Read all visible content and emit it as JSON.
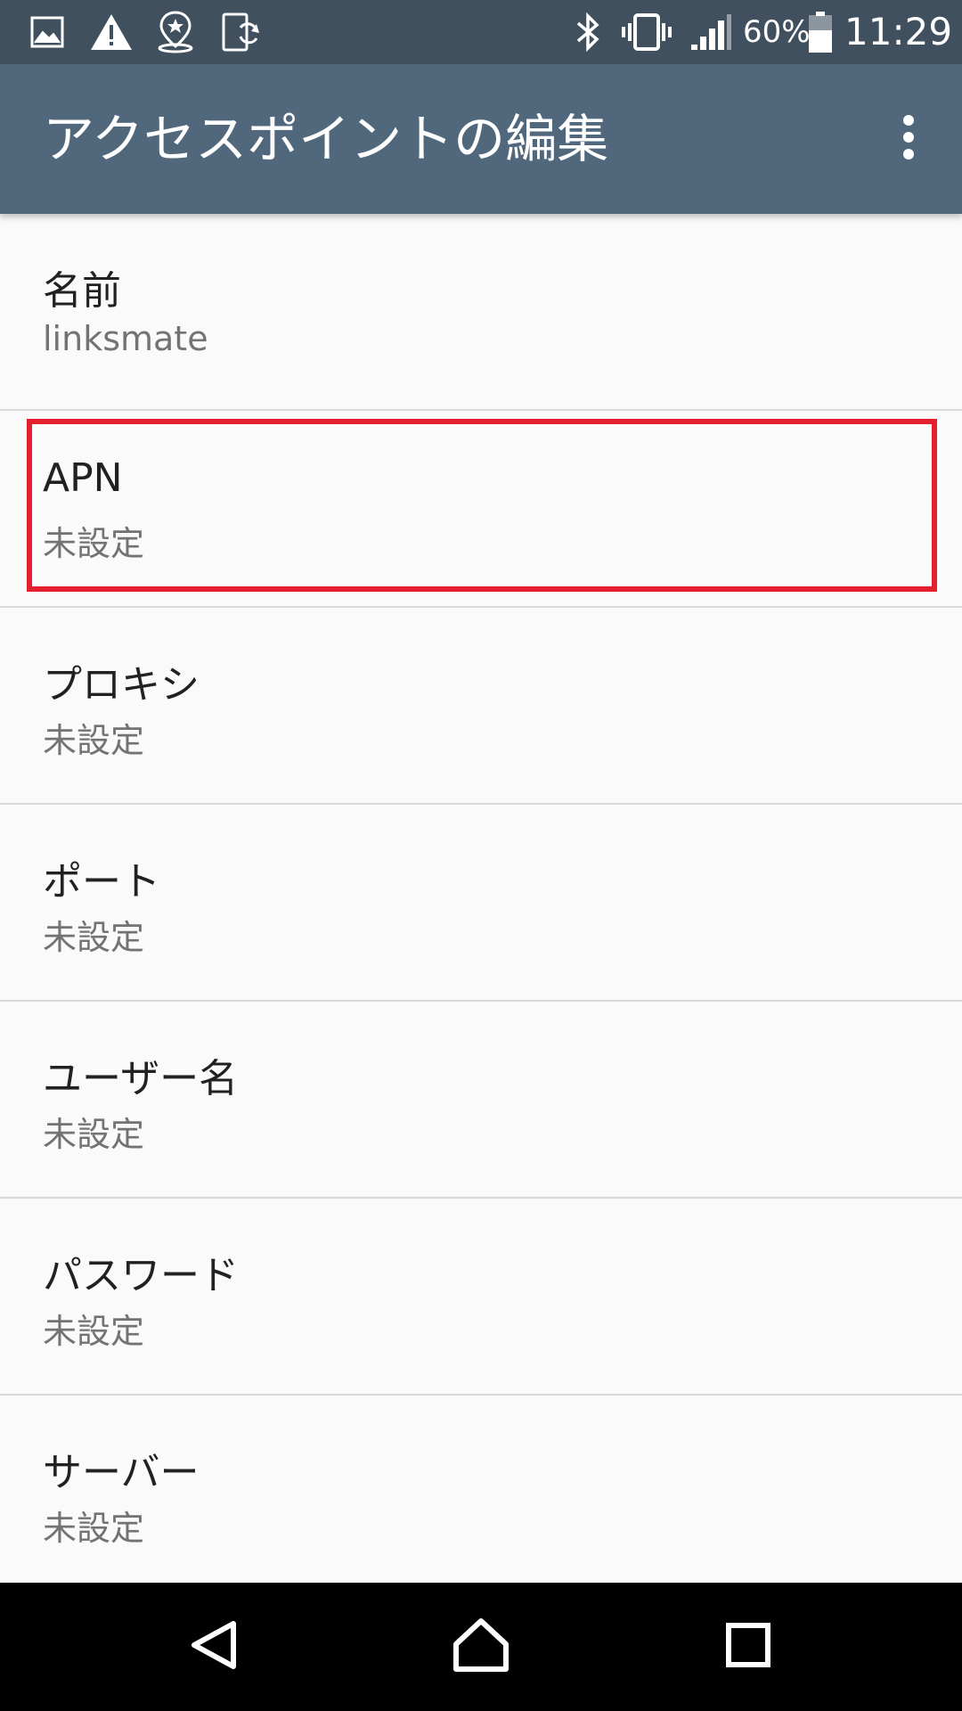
{
  "status_bar": {
    "battery_percent": "60%",
    "time": "11:29",
    "icons": [
      "image-icon",
      "warning-icon",
      "location-star-icon",
      "device-sync-icon",
      "bluetooth-icon",
      "vibrate-icon",
      "signal-icon",
      "battery-icon"
    ],
    "battery_level": 0.6
  },
  "app_bar": {
    "title": "アクセスポイントの編集",
    "overflow_icon": "more-vert-icon"
  },
  "settings": [
    {
      "title": "名前",
      "value": "linksmate"
    },
    {
      "title": "APN",
      "value": "未設定"
    },
    {
      "title": "プロキシ",
      "value": "未設定"
    },
    {
      "title": "ポート",
      "value": "未設定"
    },
    {
      "title": "ユーザー名",
      "value": "未設定"
    },
    {
      "title": "パスワード",
      "value": "未設定"
    },
    {
      "title": "サーバー",
      "value": "未設定"
    }
  ],
  "highlight": {
    "target": "APN",
    "color": "#e4202e"
  },
  "nav_bar": {
    "icons": [
      "back-icon",
      "home-icon",
      "recents-icon"
    ]
  },
  "colors": {
    "status_bar": "#40505f",
    "app_bar": "#51687c",
    "background": "#fafafa",
    "primary_text": "#212121",
    "secondary_text": "#737373"
  }
}
